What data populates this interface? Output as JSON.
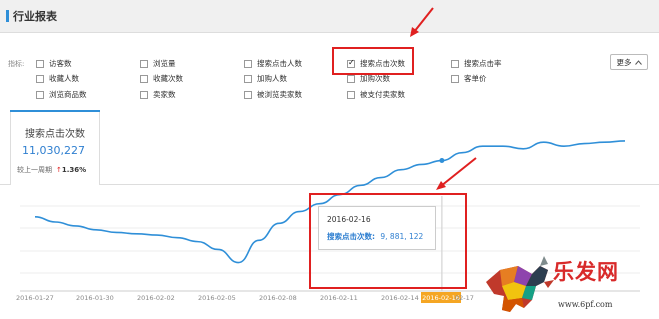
{
  "header": {
    "title": "行业报表"
  },
  "indicators": {
    "label": "指标:",
    "items": [
      {
        "label": "访客数",
        "checked": false
      },
      {
        "label": "浏览量",
        "checked": false
      },
      {
        "label": "搜索点击人数",
        "checked": false
      },
      {
        "label": "搜索点击次数",
        "checked": true
      },
      {
        "label": "搜索点击率",
        "checked": false
      },
      {
        "label": "收藏人数",
        "checked": false
      },
      {
        "label": "收藏次数",
        "checked": false
      },
      {
        "label": "加购人数",
        "checked": false
      },
      {
        "label": "加购次数",
        "checked": false
      },
      {
        "label": "客单价",
        "checked": false
      },
      {
        "label": "浏览商品数",
        "checked": false
      },
      {
        "label": "卖家数",
        "checked": false
      },
      {
        "label": "被浏览卖家数",
        "checked": false
      },
      {
        "label": "被支付卖家数",
        "checked": false
      }
    ],
    "more_label": "更多"
  },
  "metric_tab": {
    "name": "搜索点击次数",
    "value": "11,030,227",
    "compare_label": "较上一周期",
    "change_arrow": "↑",
    "change_pct": "1.36%"
  },
  "tooltip": {
    "date": "2016-02-16",
    "series_label": "搜索点击次数:",
    "value": "9, 881, 122"
  },
  "watermark": {
    "logo": "乐发网",
    "url": "www.6pf.com"
  },
  "colors": {
    "accent": "#2f8fd8",
    "highlight": "#e02020",
    "axis_highlight": "#f5a623"
  },
  "chart_data": {
    "type": "line",
    "x_ticks": [
      "2016-01-27",
      "2016-01-30",
      "2016-02-02",
      "2016-02-05",
      "2016-02-08",
      "2016-02-11",
      "2016-02-14",
      "2016-02-16",
      "02-17"
    ],
    "highlighted_tick": "2016-02-16",
    "series": [
      {
        "name": "搜索点击次数",
        "x": [
          "2016-01-27",
          "2016-01-28",
          "2016-01-29",
          "2016-01-30",
          "2016-01-31",
          "2016-02-01",
          "2016-02-02",
          "2016-02-03",
          "2016-02-04",
          "2016-02-05",
          "2016-02-06",
          "2016-02-07",
          "2016-02-08",
          "2016-02-09",
          "2016-02-10",
          "2016-02-11",
          "2016-02-12",
          "2016-02-13",
          "2016-02-14",
          "2016-02-15",
          "2016-02-16",
          "2016-02-17",
          "2016-02-18",
          "2016-02-19",
          "2016-02-20",
          "2016-02-21",
          "2016-02-22",
          "2016-02-23",
          "2016-02-24",
          "2016-02-25"
        ],
        "values": [
          5.6,
          5.2,
          4.9,
          4.6,
          4.4,
          4.3,
          4.2,
          4.0,
          3.7,
          3.1,
          2.1,
          3.8,
          5.1,
          6.0,
          6.6,
          7.3,
          8.0,
          8.6,
          9.2,
          9.6,
          9.9,
          10.5,
          11.0,
          11.0,
          10.8,
          11.3,
          11.0,
          11.2,
          11.3,
          11.4
        ],
        "unit": "millions"
      }
    ],
    "ylim": [
      0,
      13
    ],
    "grid": true
  }
}
